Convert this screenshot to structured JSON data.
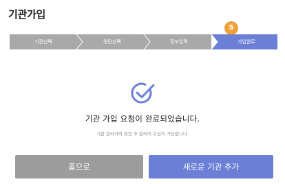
{
  "page": {
    "title": "기관가입"
  },
  "stepper": {
    "steps": [
      {
        "label": "기관선택",
        "active": false
      },
      {
        "label": "명단선택",
        "active": false
      },
      {
        "label": "정보입력",
        "active": false
      },
      {
        "label": "가입완료",
        "active": true
      }
    ],
    "current_step_number": "5",
    "colors": {
      "inactive": "#a9a9a9",
      "active": "#6b7fd7",
      "badge": "#f0a13a"
    }
  },
  "result": {
    "icon": "check-circle-icon",
    "title": "기관 가입 요청이 완료되었습니다.",
    "description": "기관 관리자의 승인 후 알리미 수신이 가능합니다."
  },
  "actions": {
    "home_label": "홈으로",
    "add_institution_label": "새로운 기관 추가"
  }
}
